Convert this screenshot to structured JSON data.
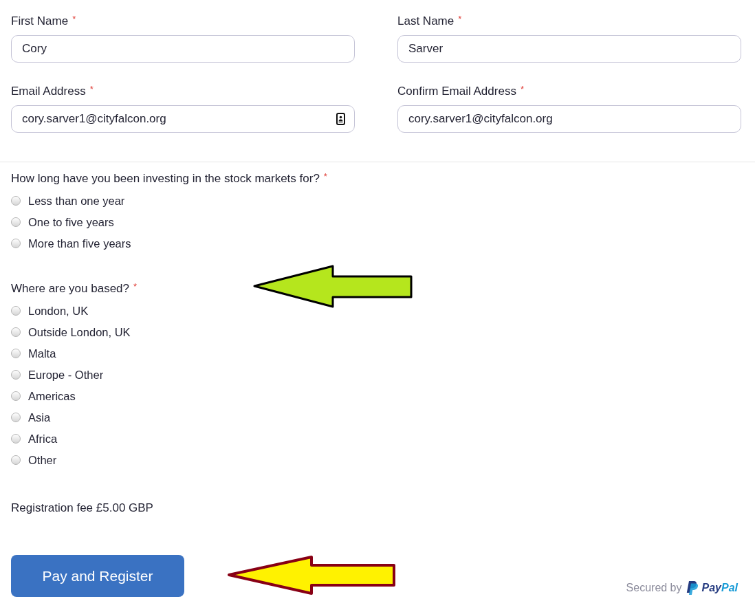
{
  "personal_fields": [
    {
      "label": "First Name",
      "required_mark": "*",
      "value": "Cory"
    },
    {
      "label": "Last Name",
      "required_mark": "*",
      "value": "Sarver"
    },
    {
      "label": "Email Address",
      "required_mark": "*",
      "value": "cory.sarver1@cityfalcon.org",
      "contact_icon": true
    },
    {
      "label": "Confirm Email Address",
      "required_mark": "*",
      "value": "cory.sarver1@cityfalcon.org"
    }
  ],
  "questions": [
    {
      "text": "How long have you been investing in the stock markets for?",
      "required_mark": "*",
      "options": [
        {
          "label": "Less than one year",
          "selected": false
        },
        {
          "label": "One to five years",
          "selected": false
        },
        {
          "label": "More than five years",
          "selected": false
        }
      ]
    },
    {
      "text": "Where are you based?",
      "required_mark": "*",
      "options": [
        {
          "label": "London, UK",
          "selected": false
        },
        {
          "label": "Outside London, UK",
          "selected": false
        },
        {
          "label": "Malta",
          "selected": false
        },
        {
          "label": "Europe - Other",
          "selected": false
        },
        {
          "label": "Americas",
          "selected": false
        },
        {
          "label": "Asia",
          "selected": false
        },
        {
          "label": "Africa",
          "selected": false
        },
        {
          "label": "Other",
          "selected": false
        }
      ],
      "arrow": {
        "color": "#b5e61d"
      }
    }
  ],
  "fee": "Registration fee £5.00 GBP",
  "submit": {
    "label": "Pay and Register",
    "arrow": {
      "color": "#fff200"
    }
  },
  "secured_by": {
    "text": "Secured by",
    "wordmark": [
      "Pay",
      "Pal"
    ]
  }
}
